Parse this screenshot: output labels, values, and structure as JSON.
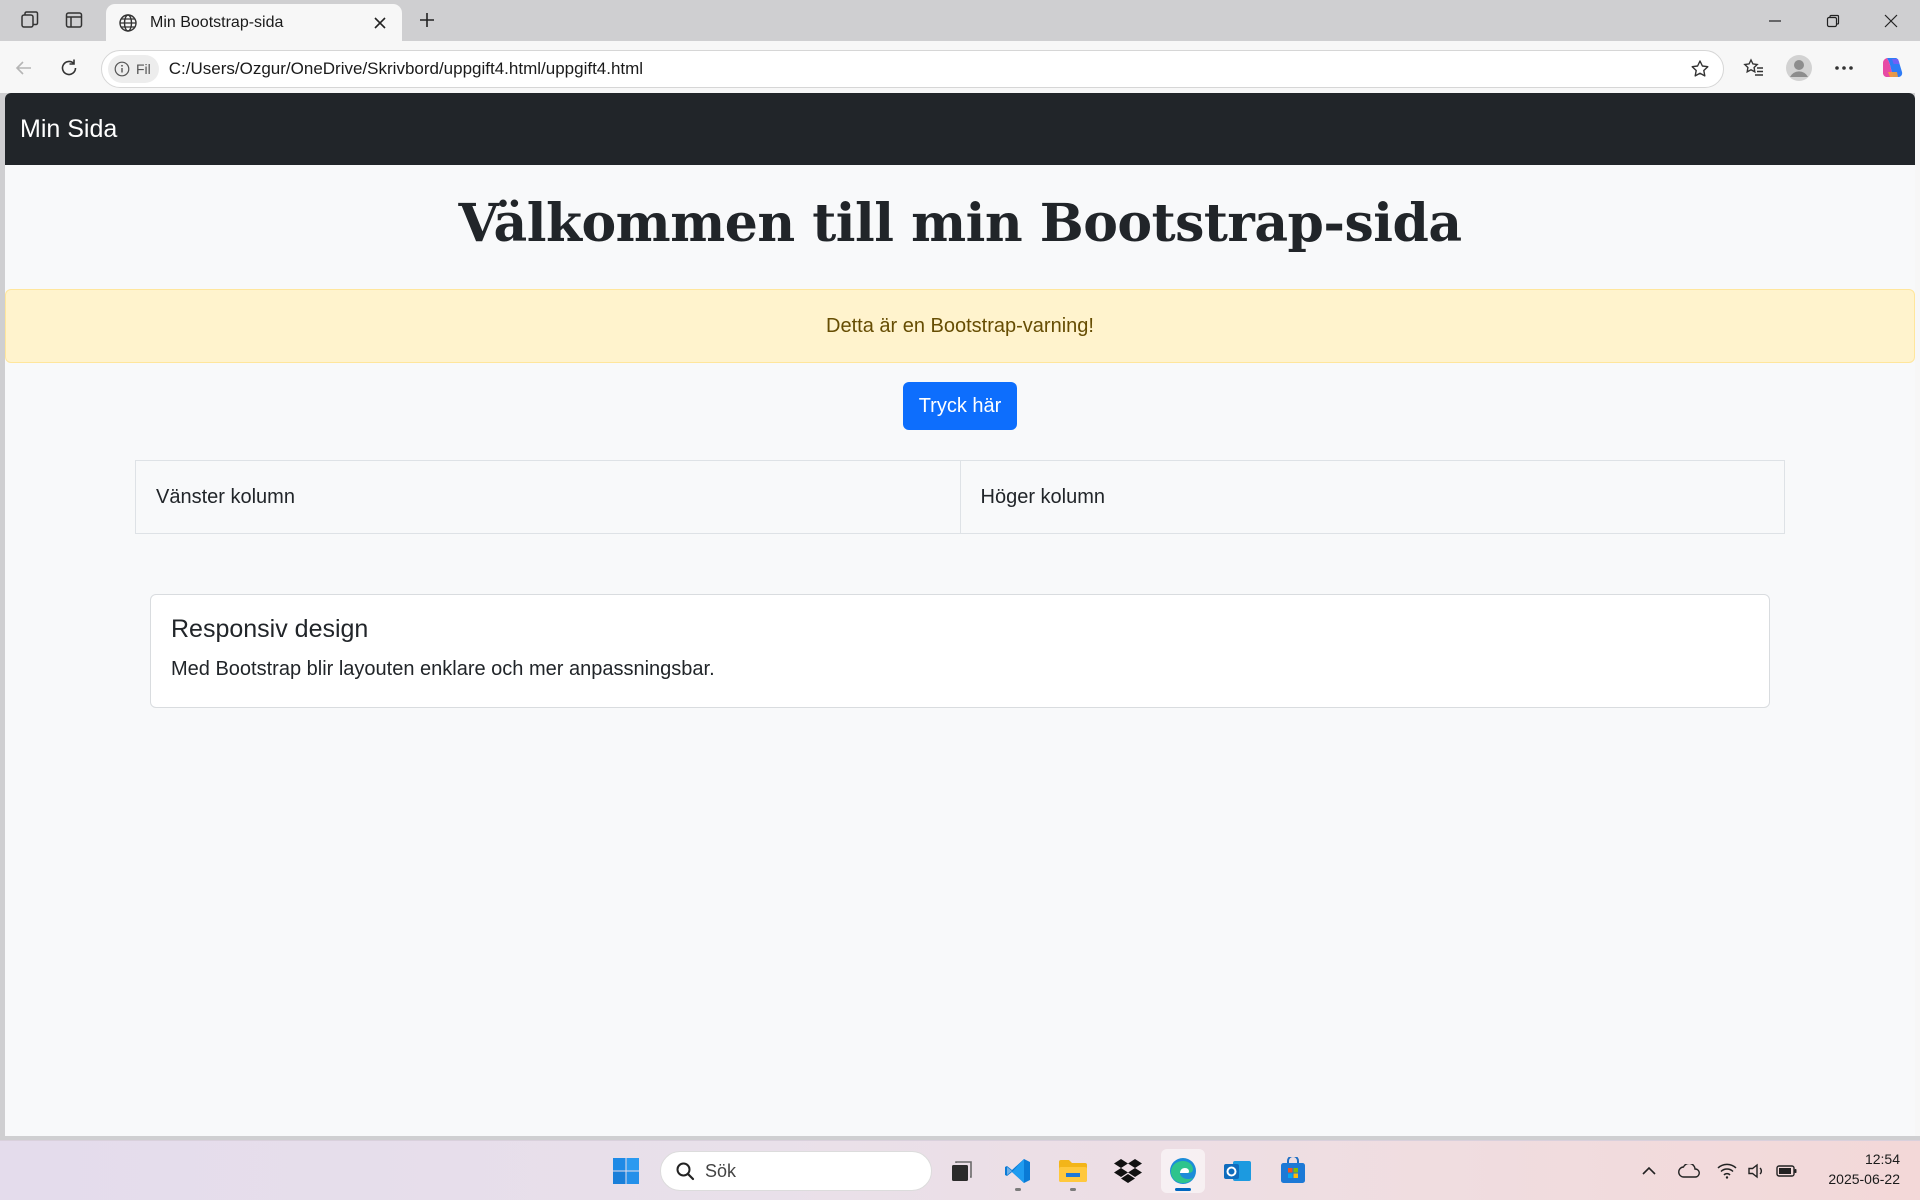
{
  "browser": {
    "tab_title": "Min Bootstrap-sida",
    "site_chip": "Fil",
    "url": "C:/Users/Ozgur/OneDrive/Skrivbord/uppgift4.html/uppgift4.html"
  },
  "page": {
    "navbar_brand": "Min Sida",
    "title": "Välkommen till min Bootstrap-sida",
    "alert_text": "Detta är en Bootstrap-varning!",
    "button_label": "Tryck här",
    "left_column": "Vänster kolumn",
    "right_column": "Höger kolumn",
    "card_title": "Responsiv design",
    "card_text": "Med Bootstrap blir layouten enklare och mer anpassningsbar."
  },
  "taskbar": {
    "search_placeholder": "Sök",
    "time": "12:54",
    "date": "2025-06-22"
  },
  "colors": {
    "navbar": "#212529",
    "primary": "#0d6efd",
    "alert_bg": "#fff3cd",
    "alert_text": "#664d03"
  }
}
